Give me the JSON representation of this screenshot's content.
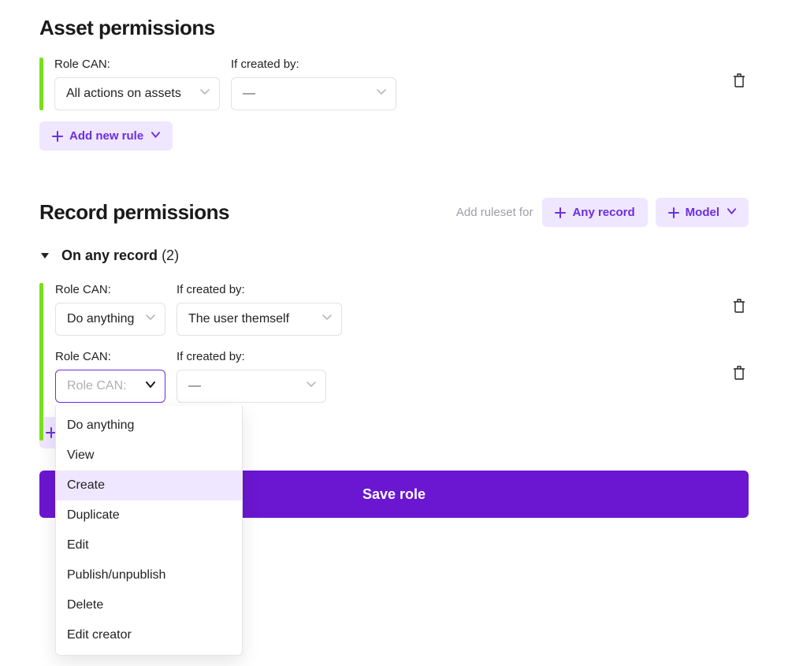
{
  "asset": {
    "title": "Asset permissions",
    "role_can_label": "Role CAN:",
    "if_created_label": "If created by:",
    "role_can_value": "All actions on assets",
    "created_by_value": "—",
    "add_rule_label": "Add new rule"
  },
  "record": {
    "title": "Record permissions",
    "add_ruleset_label": "Add ruleset for",
    "any_record_btn": "Any record",
    "model_btn": "Model",
    "collapse_title": "On any record",
    "count_text": "(2)",
    "rules": [
      {
        "role_can_label": "Role CAN:",
        "if_created_label": "If created by:",
        "role_can_value": "Do anything",
        "created_by_value": "The user themself"
      },
      {
        "role_can_label": "Role CAN:",
        "if_created_label": "If created by:",
        "role_can_placeholder": "Role CAN:",
        "created_by_value": "—"
      }
    ],
    "dropdown_options": [
      {
        "label": "Do anything",
        "highlight": false
      },
      {
        "label": "View",
        "highlight": false
      },
      {
        "label": "Create",
        "highlight": true
      },
      {
        "label": "Duplicate",
        "highlight": false
      },
      {
        "label": "Edit",
        "highlight": false
      },
      {
        "label": "Publish/unpublish",
        "highlight": false
      },
      {
        "label": "Delete",
        "highlight": false
      },
      {
        "label": "Edit creator",
        "highlight": false
      }
    ]
  },
  "save_label": "Save role",
  "colors": {
    "accent": "#6b2fe0",
    "accent_light": "#efe6ff",
    "save_bg": "#6b16d1",
    "green": "#7ae01a"
  }
}
